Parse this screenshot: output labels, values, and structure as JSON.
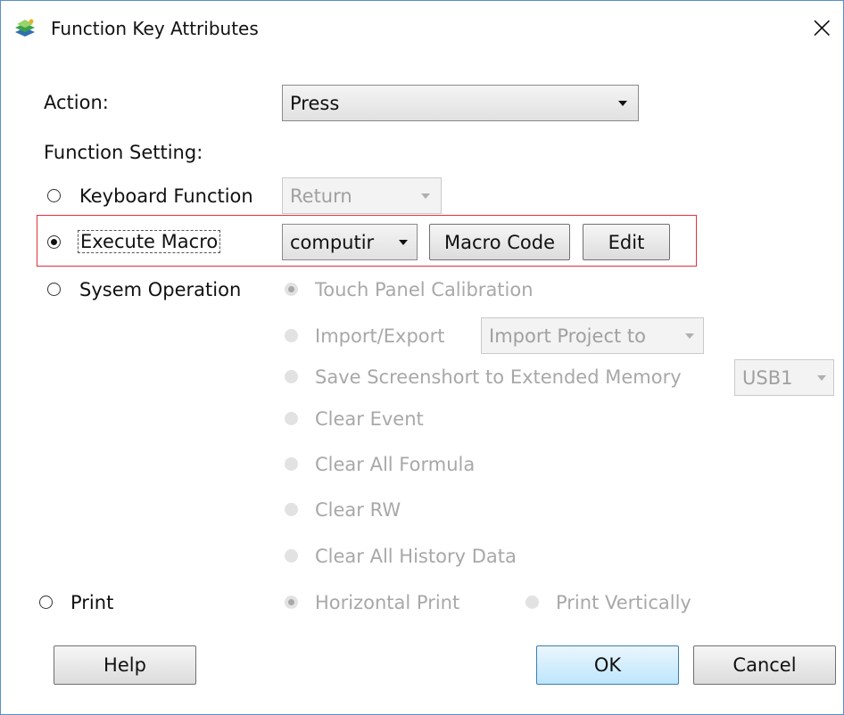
{
  "window": {
    "title": "Function Key Attributes",
    "app_icon": "app-icon",
    "close_symbol": "×"
  },
  "action": {
    "label": "Action:",
    "value": "Press"
  },
  "function_setting": {
    "label": "Function Setting:",
    "keyboard": {
      "label": "Keyboard Function",
      "selected": false,
      "dropdown_value": "Return"
    },
    "macro": {
      "label": "Execute Macro",
      "selected": true,
      "dropdown_value": "computir",
      "macro_code_button": "Macro Code",
      "edit_button": "Edit"
    },
    "system": {
      "label": "Sysem Operation",
      "selected": false,
      "options": {
        "touch_calibration": "Touch Panel Calibration",
        "import_export": "Import/Export",
        "import_export_value": "Import Project to",
        "save_screenshot": "Save Screenshort to Extended Memory",
        "save_screenshot_value": "USB1",
        "clear_event": "Clear Event",
        "clear_formula": "Clear All Formula",
        "clear_rw": "Clear RW",
        "clear_history": "Clear All History Data"
      }
    },
    "print": {
      "label": "Print",
      "selected": false,
      "horizontal": "Horizontal Print",
      "vertical": "Print Vertically"
    }
  },
  "buttons": {
    "help": "Help",
    "ok": "OK",
    "cancel": "Cancel"
  },
  "colors": {
    "highlight": "#e0323b",
    "window_border": "#5b8fc7",
    "default_button": "#bee6fd"
  }
}
